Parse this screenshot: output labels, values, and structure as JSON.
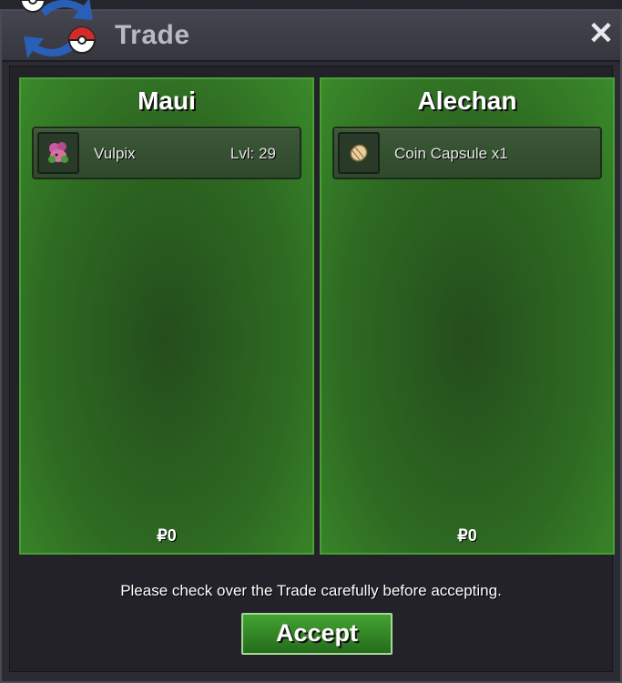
{
  "window": {
    "title": "Trade",
    "close_label": "✕"
  },
  "left": {
    "name": "Maui",
    "item": {
      "icon": "vulpix-icon",
      "label": "Vulpix",
      "level": "Lvl: 29"
    },
    "money": "₽0"
  },
  "right": {
    "name": "Alechan",
    "item": {
      "icon": "coin-capsule-icon",
      "label": "Coin Capsule  x1"
    },
    "money": "₽0"
  },
  "notice": "Please check over the Trade carefully before accepting.",
  "accept_label": "Accept",
  "colors": {
    "panel_green": "#2e6a22",
    "border_green": "#49a033",
    "title_grey": "#b9b9c2"
  }
}
